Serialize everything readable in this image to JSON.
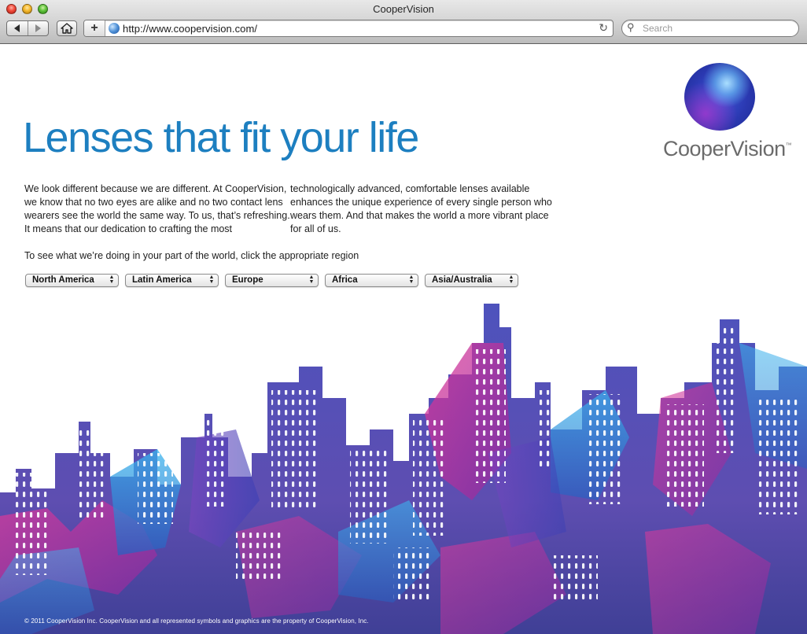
{
  "window": {
    "title": "CooperVision"
  },
  "toolbar": {
    "url": "http://www.coopervision.com/",
    "search_placeholder": "Search",
    "add_label": "+"
  },
  "page": {
    "headline": "Lenses that fit your life",
    "logo": {
      "text": "CooperVision",
      "tm": "™"
    },
    "paragraph_left": [
      "We look different because we are different. At CooperVision,",
      "we know that no two eyes are alike and no two contact lens",
      "wearers see the world the same way. To us, that’s refreshing.",
      "It means that our dedication to crafting the most"
    ],
    "paragraph_right": [
      "technologically advanced, comfortable lenses available",
      "enhances the unique experience of every single person who",
      "wears them. And that makes the world a more vibrant place",
      "for all of us."
    ],
    "region_prompt": "To see what we’re doing in your part of the world, click the appropriate region",
    "regions": [
      "North America",
      "Latin America",
      "Europe",
      "Africa",
      "Asia/Australia"
    ],
    "footer": "© 2011 CooperVision Inc. CooperVision and all represented symbols and graphics are the property of CooperVision, Inc."
  },
  "colors": {
    "headline": "#1d7fc0",
    "logo_text": "#6b6b6b",
    "city_blue": "#3a3fb5",
    "city_magenta": "#d02a8c",
    "city_cyan": "#2fa7e6",
    "city_purple": "#6a3bb0"
  }
}
